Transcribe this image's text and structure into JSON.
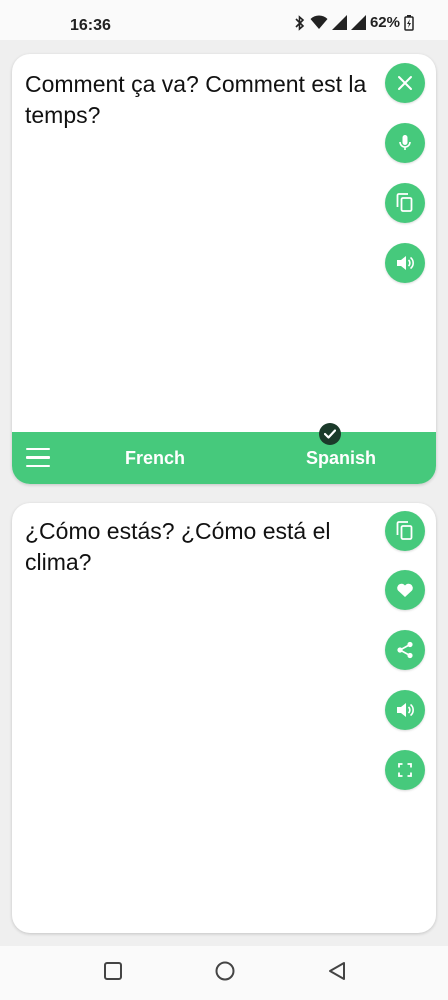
{
  "status": {
    "time": "16:36",
    "battery": "62%"
  },
  "source": {
    "text": "Comment ça va? Comment est la temps?",
    "language": "French"
  },
  "target": {
    "text": "¿Cómo estás? ¿Cómo está el clima?",
    "language": "Spanish"
  },
  "colors": {
    "accent": "#46c97c",
    "check": "#1b3a2a"
  },
  "icons": {
    "source_actions": [
      "close-icon",
      "microphone-icon",
      "copy-icon",
      "speaker-icon"
    ],
    "target_actions": [
      "copy-icon",
      "heart-icon",
      "share-icon",
      "speaker-icon",
      "fullscreen-icon"
    ],
    "nav": [
      "recents-icon",
      "home-icon",
      "back-icon"
    ]
  }
}
